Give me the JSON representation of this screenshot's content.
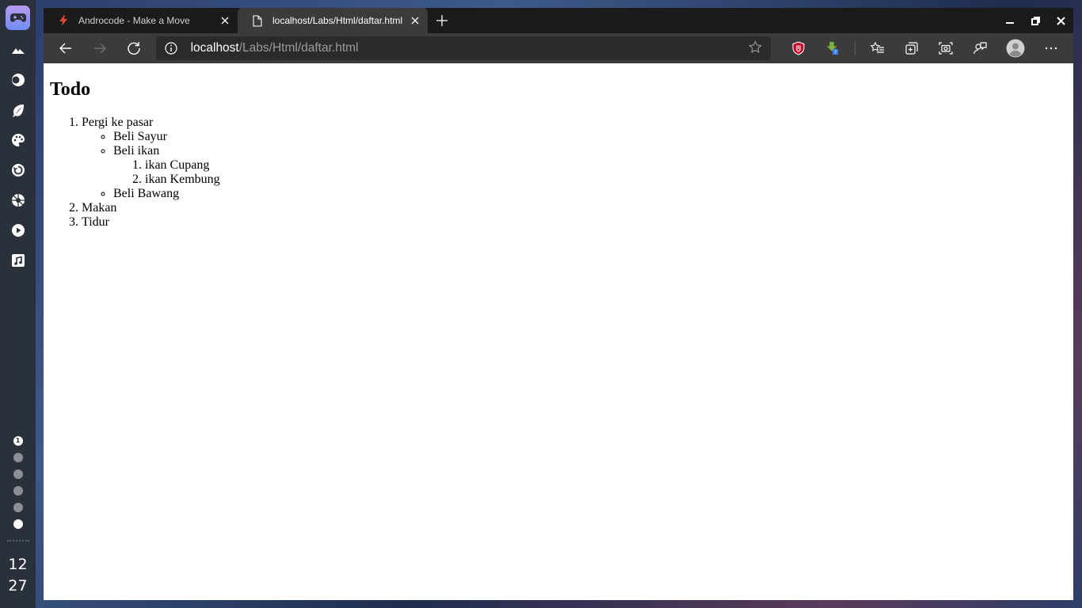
{
  "dock": {
    "icons": [
      "gamepad-icon",
      "mountain-icon",
      "toggle-icon",
      "leaf-icon",
      "palette-icon",
      "refresh-icon",
      "aperture-icon",
      "play-icon",
      "music-icon"
    ],
    "workspaces": [
      "1",
      "",
      "",
      "",
      "",
      ""
    ],
    "clock": {
      "hour": "12",
      "minute": "27"
    }
  },
  "browser": {
    "tabs": [
      {
        "title": "Androcode - Make a Move",
        "favicon": "bolt-icon"
      },
      {
        "title": "localhost/Labs/Html/daftar.html",
        "favicon": "page-icon"
      }
    ],
    "address": {
      "host": "localhost",
      "path": "/Labs/Html/daftar.html"
    },
    "colors": {
      "tabbar": "#1b1b1b",
      "toolbar": "#3b3b3b",
      "shield": "#c8102e",
      "download": "#7cb342"
    }
  },
  "page": {
    "heading": "Todo",
    "items": [
      {
        "label": "Pergi ke pasar",
        "sub": [
          {
            "label": "Beli Sayur"
          },
          {
            "label": "Beli ikan",
            "sub": [
              "ikan Cupang",
              "ikan Kembung"
            ]
          },
          {
            "label": "Beli Bawang"
          }
        ]
      },
      {
        "label": "Makan"
      },
      {
        "label": "Tidur"
      }
    ]
  }
}
